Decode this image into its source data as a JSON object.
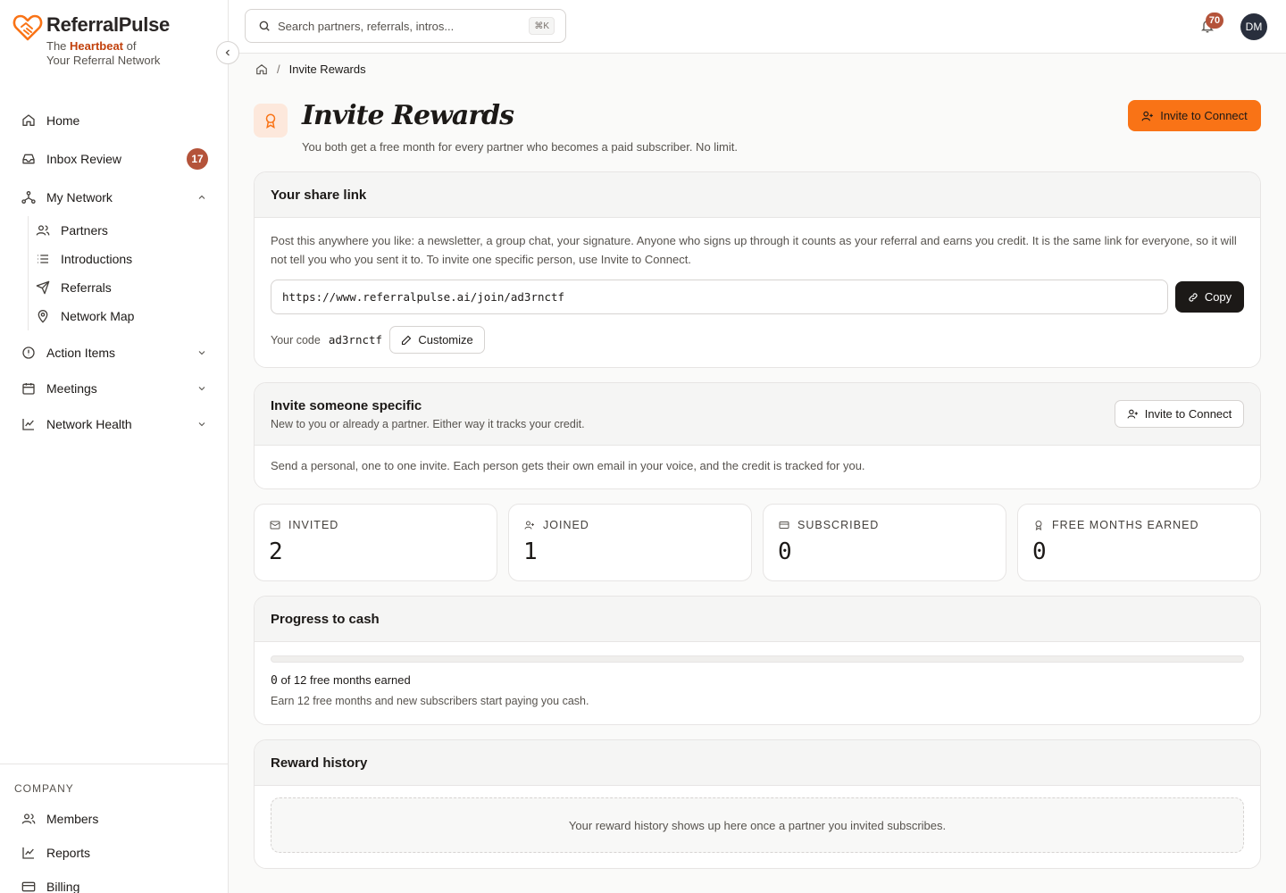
{
  "brand": {
    "name": "ReferralPulse",
    "tagline_prefix": "The",
    "tagline_highlight": "Heartbeat",
    "tagline_suffix": "of",
    "tagline_line2": "Your Referral Network",
    "accent_color": "#f97316"
  },
  "sidebar": {
    "items": [
      {
        "label": "Home",
        "icon": "home-icon"
      },
      {
        "label": "Inbox Review",
        "icon": "inbox-icon",
        "badge": "17"
      },
      {
        "label": "My Network",
        "icon": "network-icon",
        "expanded": true
      },
      {
        "label": "Action Items",
        "icon": "alert-circle-icon"
      },
      {
        "label": "Meetings",
        "icon": "calendar-icon"
      },
      {
        "label": "Network Health",
        "icon": "chart-line-icon"
      }
    ],
    "network_sub": [
      {
        "label": "Partners",
        "icon": "users-icon"
      },
      {
        "label": "Introductions",
        "icon": "list-icon"
      },
      {
        "label": "Referrals",
        "icon": "send-icon"
      },
      {
        "label": "Network Map",
        "icon": "map-pin-icon"
      }
    ],
    "company_label": "COMPANY",
    "company_items": [
      {
        "label": "Members",
        "icon": "users-icon"
      },
      {
        "label": "Reports",
        "icon": "chart-line-icon"
      },
      {
        "label": "Billing",
        "icon": "credit-card-icon"
      }
    ]
  },
  "topbar": {
    "search_placeholder": "Search partners, referrals, intros...",
    "search_shortcut": "⌘K",
    "notification_count": "70",
    "avatar_initials": "DM"
  },
  "breadcrumb": {
    "current": "Invite Rewards"
  },
  "header": {
    "title": "Invite Rewards",
    "subtitle": "You both get a free month for every partner who becomes a paid subscriber. No limit.",
    "primary_button": "Invite to Connect"
  },
  "share_link": {
    "title": "Your share link",
    "description": "Post this anywhere you like: a newsletter, a group chat, your signature. Anyone who signs up through it counts as your referral and earns you credit. It is the same link for everyone, so it will not tell you who you sent it to. To invite one specific person, use Invite to Connect.",
    "url": "https://www.referralpulse.ai/join/ad3rnctf",
    "copy_label": "Copy",
    "code_label": "Your code",
    "code": "ad3rnctf",
    "customize_label": "Customize"
  },
  "invite_specific": {
    "title": "Invite someone specific",
    "subtitle": "New to you or already a partner. Either way it tracks your credit.",
    "button": "Invite to Connect",
    "body": "Send a personal, one to one invite. Each person gets their own email in your voice, and the credit is tracked for you."
  },
  "stats": [
    {
      "label": "INVITED",
      "value": "2",
      "icon": "mail-icon"
    },
    {
      "label": "JOINED",
      "value": "1",
      "icon": "user-plus-icon"
    },
    {
      "label": "SUBSCRIBED",
      "value": "0",
      "icon": "credit-card-icon"
    },
    {
      "label": "FREE MONTHS EARNED",
      "value": "0",
      "icon": "award-icon"
    }
  ],
  "progress": {
    "title": "Progress to cash",
    "earned": "0",
    "total": "12",
    "fraction": 0,
    "earned_suffix": "free months earned",
    "note": "Earn 12 free months and new subscribers start paying you cash."
  },
  "history": {
    "title": "Reward history",
    "empty": "Your reward history shows up here once a partner you invited subscribes."
  }
}
